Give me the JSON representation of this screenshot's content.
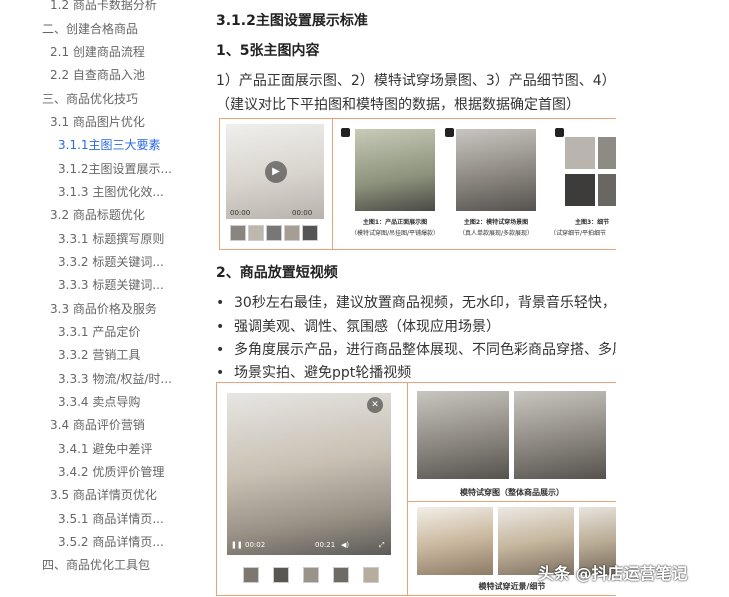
{
  "sidebar": {
    "items": [
      {
        "label": "1.2 商品卡数据分析"
      },
      {
        "label": "二、创建合格商品"
      },
      {
        "label": "2.1 创建商品流程"
      },
      {
        "label": "2.2 自查商品入池"
      },
      {
        "label": "三、商品优化技巧"
      },
      {
        "label": "3.1 商品图片优化"
      },
      {
        "label": "3.1.1主图三大要素"
      },
      {
        "label": "3.1.2主图设置展示..."
      },
      {
        "label": "3.1.3 主图优化效..."
      },
      {
        "label": "3.2 商品标题优化"
      },
      {
        "label": "3.3.1 标题撰写原则"
      },
      {
        "label": "3.3.2 标题关键词..."
      },
      {
        "label": "3.3.3 标题关键词..."
      },
      {
        "label": "3.3 商品价格及服务"
      },
      {
        "label": "3.3.1 产品定价"
      },
      {
        "label": "3.3.2 营销工具"
      },
      {
        "label": "3.3.3 物流/权益/时..."
      },
      {
        "label": "3.3.4 卖点导购"
      },
      {
        "label": "3.4 商品评价营销"
      },
      {
        "label": "3.4.1 避免中差评"
      },
      {
        "label": "3.4.2 优质评价管理"
      },
      {
        "label": "3.5 商品详情页优化"
      },
      {
        "label": "3.5.1 商品详情页..."
      },
      {
        "label": "3.5.2 商品详情页..."
      },
      {
        "label": "四、商品优化工具包"
      }
    ]
  },
  "main": {
    "section_title": "3.1.2主图设置展示标准",
    "sub1_title": "1、5张主图内容",
    "sub1_line1": "1）产品正面展示图、2）模特试穿场景图、3）产品细节图、4）产品",
    "sub1_line2": "（建议对比下平拍图和模特图的数据，根据数据确定首图）",
    "image1": {
      "video_time_left": "00:00",
      "video_time_right": "00:00",
      "cap1_title": "主图1：产品正面展示图",
      "cap1_sub": "（模特试穿图/吊挂图/平铺爆款）",
      "cap2_title": "主图2：模特试穿场景图",
      "cap2_sub": "（真人单款展现/多款展现）",
      "cap3_title": "主图3：细节",
      "cap3_sub": "（试穿细节/平拍细节"
    },
    "sub2_title": "2、商品放置短视频",
    "bullets": [
      "30秒左右最佳，建议放置商品视频，无水印，背景音乐轻快，视频",
      "强调美观、调性、氛围感（体现应用场景）",
      "多角度展示产品，进行商品整体展现、不同色彩商品穿搭、多风格",
      "场景实拍、避免ppt轮播视频"
    ],
    "image2": {
      "time_left": "00:02",
      "time_right": "00:21",
      "cap_top": "模特试穿图（整体商品展示）",
      "cap_bottom": "模特试穿近景/细节"
    }
  },
  "watermark": "头条 @抖店运营笔记",
  "colors": {
    "accent": "#2a6ae6",
    "frame": "#e9a27a"
  }
}
